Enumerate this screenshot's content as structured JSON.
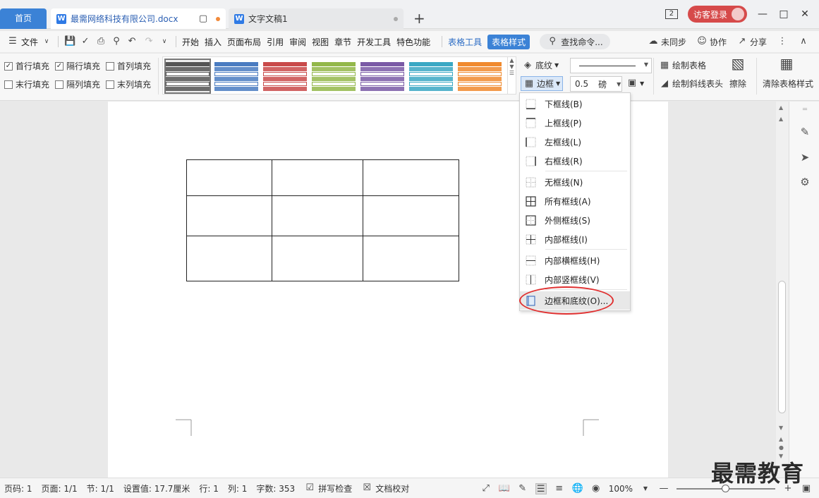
{
  "titlebar": {
    "home_tab": "首页",
    "doc_tab_1": "最需网络科技有限公司.docx",
    "doc_tab_2": "文字文稿1",
    "page_count_badge": "2",
    "visitor_login": "访客登录"
  },
  "menubar": {
    "file": "文件",
    "items": [
      "开始",
      "插入",
      "页面布局",
      "引用",
      "审阅",
      "视图",
      "章节",
      "开发工具",
      "特色功能"
    ],
    "table_tools": "表格工具",
    "table_style": "表格样式",
    "search_placeholder": "查找命令...",
    "unsync": "未同步",
    "collab": "协作",
    "share": "分享"
  },
  "ribbon": {
    "checks": [
      {
        "label": "首行填充",
        "checked": true
      },
      {
        "label": "隔行填充",
        "checked": true
      },
      {
        "label": "首列填充",
        "checked": false
      },
      {
        "label": "末行填充",
        "checked": false
      },
      {
        "label": "隔列填充",
        "checked": false
      },
      {
        "label": "末列填充",
        "checked": false
      }
    ],
    "style_colors": [
      "#555555",
      "#4a7cc1",
      "#c94a4a",
      "#93b84a",
      "#7a5aa6",
      "#3aa8c4",
      "#f08a2e"
    ],
    "shading": "底纹",
    "border": "边框",
    "line_width": "0.5",
    "unit": "磅",
    "draw_table": "绘制表格",
    "draw_diagonal": "绘制斜线表头",
    "erase": "擦除",
    "clear_style": "清除表格样式"
  },
  "dropdown": {
    "items": [
      {
        "label": "下框线(B)",
        "icon": "bottom-border-icon"
      },
      {
        "label": "上框线(P)",
        "icon": "top-border-icon"
      },
      {
        "label": "左框线(L)",
        "icon": "left-border-icon"
      },
      {
        "label": "右框线(R)",
        "icon": "right-border-icon"
      },
      {
        "label": "无框线(N)",
        "icon": "no-border-icon"
      },
      {
        "label": "所有框线(A)",
        "icon": "all-borders-icon"
      },
      {
        "label": "外侧框线(S)",
        "icon": "outside-borders-icon"
      },
      {
        "label": "内部框线(I)",
        "icon": "inside-borders-icon"
      },
      {
        "label": "内部横框线(H)",
        "icon": "inside-horizontal-border-icon"
      },
      {
        "label": "内部竖框线(V)",
        "icon": "inside-vertical-border-icon"
      },
      {
        "label": "边框和底纹(O)...",
        "icon": "borders-and-shading-icon"
      }
    ]
  },
  "statusbar": {
    "page_num": "页码: 1",
    "pages": "页面: 1/1",
    "section": "节: 1/1",
    "setting": "设置值: 17.7厘米",
    "row": "行: 1",
    "col": "列: 1",
    "word_count": "字数: 353",
    "spell_check": "拼写检查",
    "doc_proof": "文档校对",
    "zoom": "100%",
    "zoom_level": 1.0
  },
  "watermark": "最需教育",
  "accent_color": "#3b82d6",
  "highlight_color": "#e03030"
}
